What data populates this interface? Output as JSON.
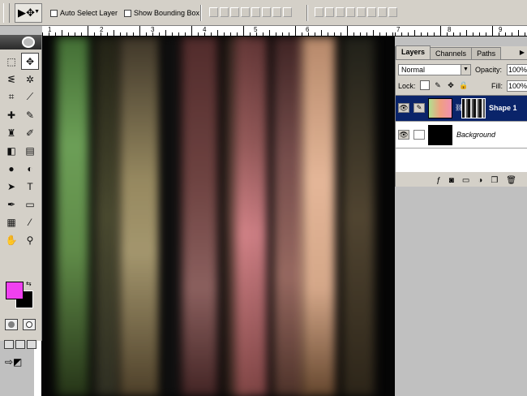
{
  "options_bar": {
    "auto_select_label": "Auto Select Layer",
    "show_bounding_label": "Show Bounding Box"
  },
  "ruler": {
    "top_numbers": [
      "1",
      "2",
      "3",
      "4",
      "5",
      "6",
      "7",
      "8",
      "9"
    ]
  },
  "tools": [
    {
      "name": "marquee-tool",
      "glyph": "⬚"
    },
    {
      "name": "move-tool",
      "glyph": "✥"
    },
    {
      "name": "lasso-tool",
      "glyph": "ᓬ"
    },
    {
      "name": "magic-wand-tool",
      "glyph": "✲"
    },
    {
      "name": "crop-tool",
      "glyph": "⌗"
    },
    {
      "name": "slice-tool",
      "glyph": "⟋"
    },
    {
      "name": "healing-brush-tool",
      "glyph": "✚"
    },
    {
      "name": "brush-tool",
      "glyph": "✎"
    },
    {
      "name": "clone-stamp-tool",
      "glyph": "♜"
    },
    {
      "name": "history-brush-tool",
      "glyph": "✐"
    },
    {
      "name": "eraser-tool",
      "glyph": "◧"
    },
    {
      "name": "gradient-tool",
      "glyph": "▤"
    },
    {
      "name": "blur-tool",
      "glyph": "●"
    },
    {
      "name": "dodge-tool",
      "glyph": "◐"
    },
    {
      "name": "path-selection-tool",
      "glyph": "➤"
    },
    {
      "name": "type-tool",
      "glyph": "T"
    },
    {
      "name": "pen-tool",
      "glyph": "✒"
    },
    {
      "name": "shape-tool",
      "glyph": "▭"
    },
    {
      "name": "notes-tool",
      "glyph": "▦"
    },
    {
      "name": "eyedropper-tool",
      "glyph": "⁄"
    },
    {
      "name": "hand-tool",
      "glyph": "✋"
    },
    {
      "name": "zoom-tool",
      "glyph": "⚲"
    }
  ],
  "colors": {
    "foreground": "#f040f0",
    "background": "#000000"
  },
  "layers_panel": {
    "tabs": [
      "Layers",
      "Channels",
      "Paths"
    ],
    "blend_mode": "Normal",
    "opacity_label": "Opacity:",
    "opacity_value": "100%",
    "lock_label": "Lock:",
    "fill_label": "Fill:",
    "fill_value": "100%",
    "layers": [
      {
        "name": "Shape 1",
        "selected": true
      },
      {
        "name": "Background",
        "selected": false
      }
    ]
  }
}
